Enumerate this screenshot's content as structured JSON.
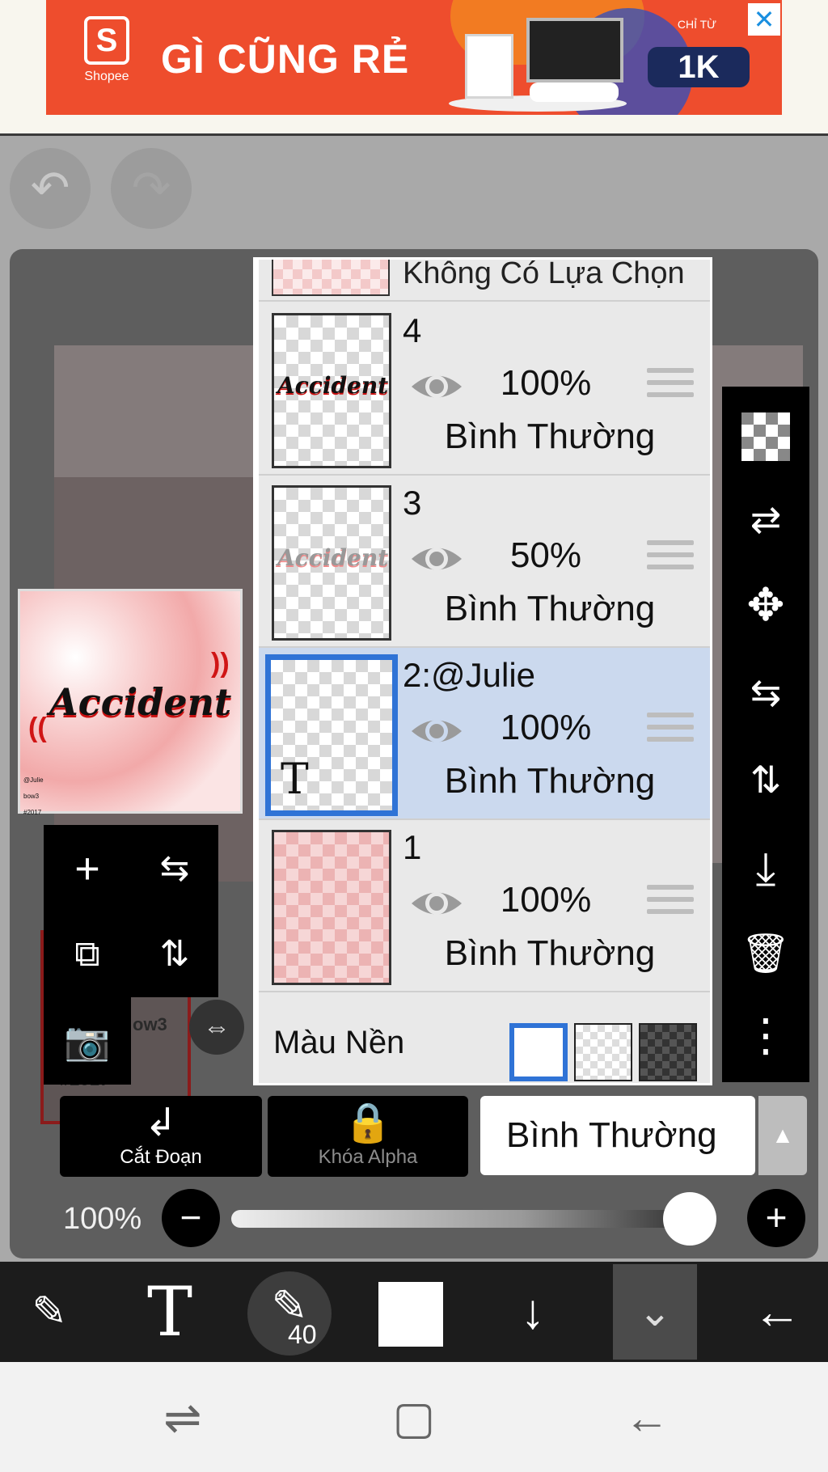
{
  "ad": {
    "brand": "Shopee",
    "logo_letter": "S",
    "headline": "GÌ CŨNG RẺ",
    "price_caption": "CHỈ TỪ",
    "price": "1K",
    "info_icon": "info-icon",
    "close_icon": "close-icon",
    "colors": {
      "background": "#ee4d2d",
      "price_badge": "#1b2a5c"
    }
  },
  "history": {
    "undo_icon": "undo-icon",
    "redo_icon": "redo-icon"
  },
  "canvas": {
    "preview_text": "Accident",
    "preview_small_lines": [
      "@Julie",
      "bow3",
      "#2017"
    ],
    "frame_text_1": "ow3",
    "frame_text_2": "#2017"
  },
  "layer_panel": {
    "selection_label": "Không Có Lựa Chọn",
    "layers": [
      {
        "name": "4",
        "opacity": "100%",
        "blend": "Bình Thường",
        "thumb_text": "Accident",
        "active": false
      },
      {
        "name": "3",
        "opacity": "50%",
        "blend": "Bình Thường",
        "thumb_text": "Accident",
        "active": false
      },
      {
        "name": "2:@Julie",
        "opacity": "100%",
        "blend": "Bình Thường",
        "thumb_text": "T",
        "active": true
      },
      {
        "name": "1",
        "opacity": "100%",
        "blend": "Bình Thường",
        "thumb_text": "",
        "active": false
      }
    ],
    "background_label": "Màu Nền",
    "background_options": [
      "white",
      "transparent",
      "dark"
    ],
    "background_selected": "white",
    "colors": {
      "active_row": "#cbd9ee",
      "active_border": "#2f73d6"
    }
  },
  "right_toolbar": {
    "icons": [
      "transparency-icon",
      "swap-layer-icon",
      "move-icon",
      "flip-horizontal-icon",
      "flip-vertical-icon",
      "merge-down-icon",
      "trash-icon",
      "more-icon"
    ]
  },
  "layer_tools": {
    "icons": [
      "add-layer-icon",
      "flip-horizontal-icon",
      "copy-layer-icon",
      "flip-vertical-icon",
      "camera-icon"
    ]
  },
  "actions": {
    "clip_label": "Cắt Đoạn",
    "alpha_lock_label": "Khóa Alpha",
    "blend_mode": "Bình Thường",
    "blend_arrow_icon": "triangle-up-icon"
  },
  "opacity": {
    "label": "100%",
    "value": 1.0
  },
  "bottom_toolbar": {
    "brush_size": "40",
    "icons": [
      "tool-swap-icon",
      "text-tool-icon",
      "pen-icon",
      "color-swatch",
      "arrow-down-icon",
      "chevron-double-down-icon",
      "back-arrow-icon"
    ],
    "current_color": "#ffffff"
  },
  "system_nav": {
    "icons": [
      "recent-apps-icon",
      "home-icon",
      "back-icon"
    ]
  }
}
